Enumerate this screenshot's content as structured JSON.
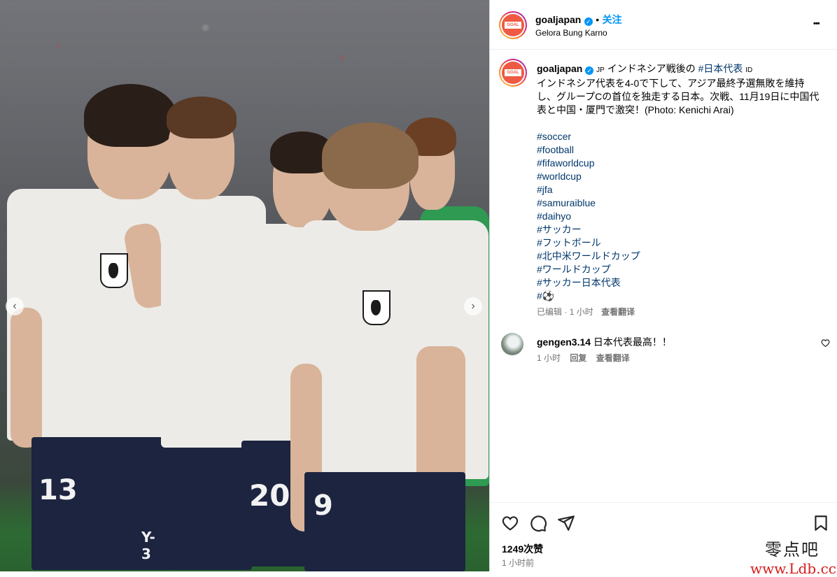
{
  "post": {
    "username": "goaljapan",
    "follow_label": "关注",
    "separator": "•",
    "location": "Gelora Bung Karno",
    "more_label": "•••",
    "avatar_text": "GOAL",
    "verified_mark": "✓"
  },
  "caption": {
    "username": "goaljapan",
    "lang_jp": "JP",
    "intro": "インドネシア戦後の",
    "intro_tag": "#日本代表",
    "lang_id": "ID",
    "body": "インドネシア代表を4-0で下して、アジア最終予選無敗を維持し、グループCの首位を独走する日本。次戦、11月19日に中国代表と中国・厦門で激突！(Photo: Kenichi Arai)",
    "hashtags": [
      "#soccer",
      "#football",
      "#fifaworldcup",
      "#worldcup",
      "#jfa",
      "#samuraiblue",
      "#daihyo",
      "#サッカー",
      "#フットボール",
      "#北中米ワールドカップ",
      "#ワールドカップ",
      "#サッカー日本代表",
      "#⚽"
    ],
    "edited": "已编辑",
    "dot": "·",
    "time": "1 小时",
    "translate": "查看翻译"
  },
  "comment": {
    "username": "gengen3.14",
    "text": "日本代表最高！！",
    "time": "1 小时",
    "reply": "回复",
    "translate": "查看翻译"
  },
  "footer": {
    "likes": "1249次赞",
    "posted": "1 小时前"
  },
  "photo": {
    "jersey_numbers": [
      "13",
      "20",
      "9"
    ],
    "brand": "Y-3",
    "prev_icon": "‹",
    "next_icon": "›"
  },
  "watermark": {
    "line1": "零点吧",
    "line2": "www.Ldb.cc"
  },
  "colors": {
    "link": "#00376b",
    "accent": "#0095f6",
    "muted": "#737373"
  }
}
